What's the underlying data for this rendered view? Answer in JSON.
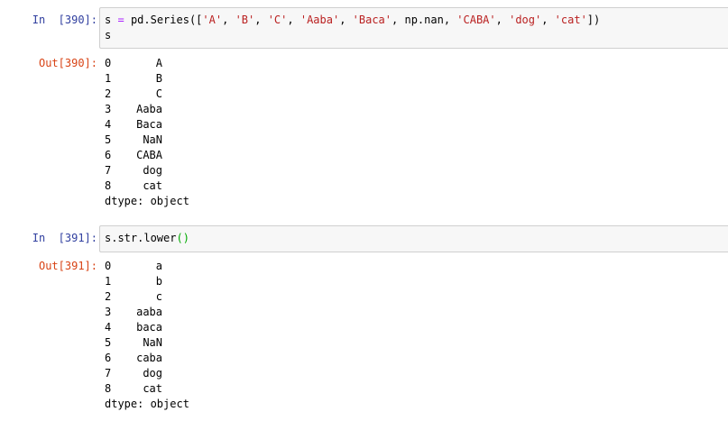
{
  "cells": [
    {
      "in_prompt": "In  [390]:",
      "out_prompt": "Out[390]:",
      "code": {
        "line1": {
          "var": "s",
          "eq": "=",
          "call_start": "pd.Series([",
          "args": [
            "'A'",
            "'B'",
            "'C'",
            "'Aaba'",
            "'Baca'",
            "np.nan",
            "'CABA'",
            "'dog'",
            "'cat'"
          ],
          "call_end": "])"
        },
        "line2": "s"
      },
      "output": {
        "rows": [
          {
            "index": "0",
            "value": "A"
          },
          {
            "index": "1",
            "value": "B"
          },
          {
            "index": "2",
            "value": "C"
          },
          {
            "index": "3",
            "value": "Aaba"
          },
          {
            "index": "4",
            "value": "Baca"
          },
          {
            "index": "5",
            "value": "NaN"
          },
          {
            "index": "6",
            "value": "CABA"
          },
          {
            "index": "7",
            "value": "dog"
          },
          {
            "index": "8",
            "value": "cat"
          }
        ],
        "dtype": "dtype: object"
      }
    },
    {
      "in_prompt": "In  [391]:",
      "out_prompt": "Out[391]:",
      "code": {
        "line1": {
          "text": "s.str.lower",
          "paren": "()"
        }
      },
      "output": {
        "rows": [
          {
            "index": "0",
            "value": "a"
          },
          {
            "index": "1",
            "value": "b"
          },
          {
            "index": "2",
            "value": "c"
          },
          {
            "index": "3",
            "value": "aaba"
          },
          {
            "index": "4",
            "value": "baca"
          },
          {
            "index": "5",
            "value": "NaN"
          },
          {
            "index": "6",
            "value": "caba"
          },
          {
            "index": "7",
            "value": "dog"
          },
          {
            "index": "8",
            "value": "cat"
          }
        ],
        "dtype": "dtype: object"
      }
    }
  ],
  "colors": {
    "in_prompt": "#303f9f",
    "out_prompt": "#d84315",
    "string": "#ba2121",
    "operator": "#aa22ff",
    "matched_paren": "#00aa00",
    "input_bg": "#f7f7f7",
    "input_border": "#cfcfcf"
  }
}
